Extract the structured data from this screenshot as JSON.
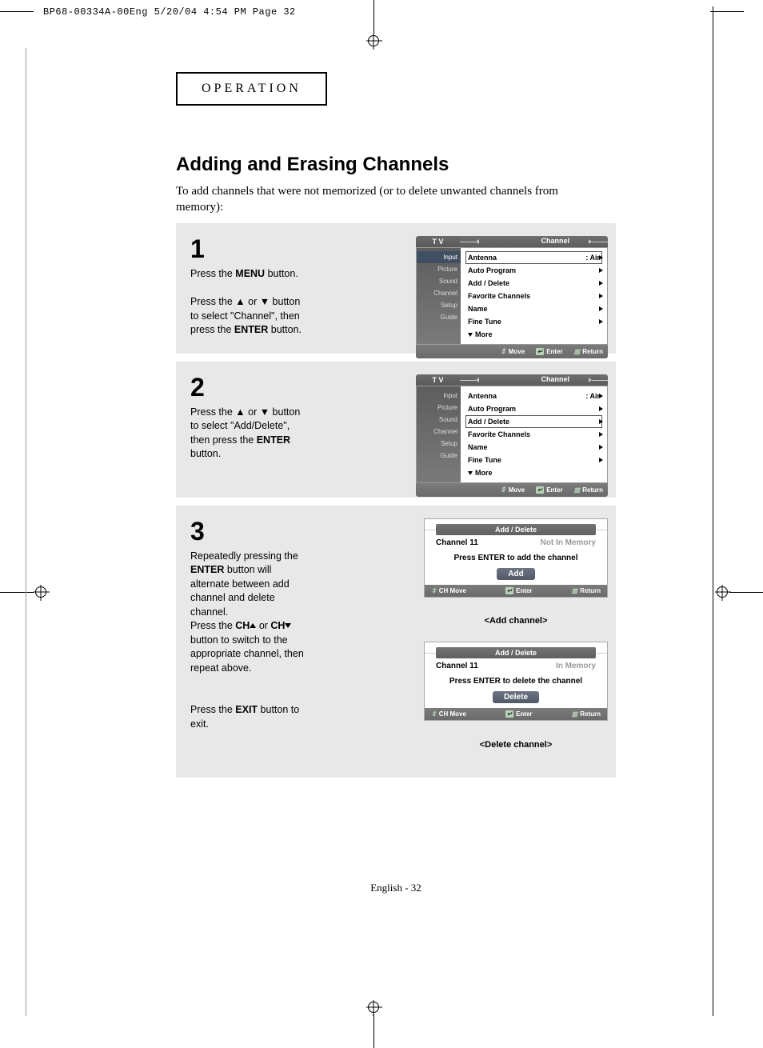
{
  "header": "BP68-00334A-00Eng  5/20/04  4:54 PM  Page 32",
  "section": "OPERATION",
  "title": "Adding and Erasing Channels",
  "intro": "To add channels that were not memorized (or to delete unwanted channels from memory):",
  "steps": {
    "s1": {
      "num": "1",
      "text1a": "Press the ",
      "text1b": "MENU",
      "text1c": " button.",
      "text2a": "Press the ▲ or ▼ button to select \"Channel\", then press the ",
      "text2b": "ENTER",
      "text2c": " button."
    },
    "s2": {
      "num": "2",
      "text1a": "Press the ▲ or ▼ button to select \"Add/Delete\", then press the ",
      "text1b": "ENTER",
      "text1c": " button."
    },
    "s3": {
      "num": "3",
      "text1a": "Repeatedly pressing the ",
      "text1b": "ENTER",
      "text1c": " button will alternate between add channel and delete channel.",
      "text2a": "Press the ",
      "text2b": "CH",
      "text2c": " or ",
      "text2d": "CH",
      "text2e": " button to switch to the appropriate channel, then repeat above.",
      "text3a": "Press the ",
      "text3b": "EXIT",
      "text3c": " button to exit."
    }
  },
  "osd": {
    "tv": "T V",
    "title": "Channel",
    "side": [
      "Input",
      "Picture",
      "Sound",
      "Channel",
      "Setup",
      "Guide"
    ],
    "rows": {
      "antenna": "Antenna",
      "antenna_val": ":   Air",
      "auto": "Auto Program",
      "add": "Add / Delete",
      "fav": "Favorite Channels",
      "name": "Name",
      "fine": "Fine Tune",
      "more": "More"
    },
    "footer": {
      "move": "Move",
      "enter": "Enter",
      "return": "Return"
    }
  },
  "popup_add": {
    "title": "Add / Delete",
    "ch": "Channel 11",
    "status": "Not In Memory",
    "line": "Press ENTER to add the channel",
    "btn": "Add",
    "caption": "<Add channel>",
    "foot": {
      "ch": "CH Move",
      "enter": "Enter",
      "return": "Return"
    }
  },
  "popup_del": {
    "title": "Add / Delete",
    "ch": "Channel 11",
    "status": "In Memory",
    "line": "Press ENTER to delete the channel",
    "btn": "Delete",
    "caption": "<Delete channel>",
    "foot": {
      "ch": "CH Move",
      "enter": "Enter",
      "return": "Return"
    }
  },
  "page_num": "English - 32"
}
